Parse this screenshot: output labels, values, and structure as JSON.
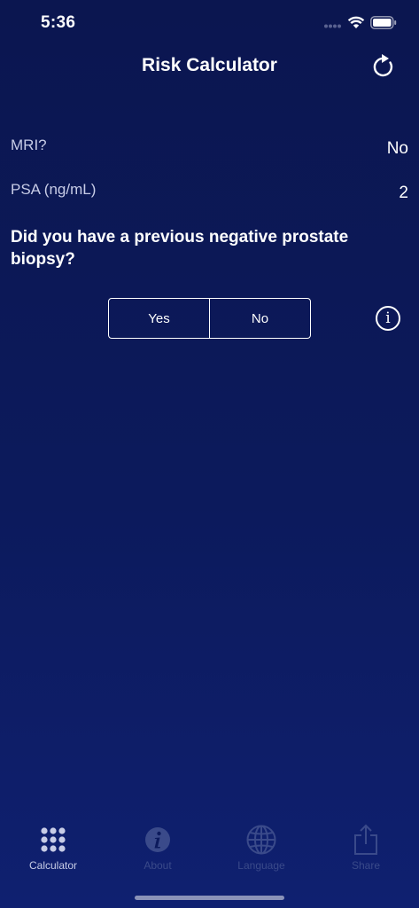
{
  "status_bar": {
    "time": "5:36"
  },
  "nav": {
    "title": "Risk Calculator",
    "refresh_icon": "refresh-icon"
  },
  "rows": [
    {
      "label": "MRI?",
      "value": "No"
    },
    {
      "label": "PSA (ng/mL)",
      "value": "2"
    }
  ],
  "question": {
    "text": "Did you have a previous negative prostate biopsy?",
    "options": [
      "Yes",
      "No"
    ],
    "info_icon": "info-icon",
    "info_glyph": "i"
  },
  "tabs": [
    {
      "label": "Calculator",
      "icon": "grid-icon",
      "active": true
    },
    {
      "label": "About",
      "icon": "info-icon",
      "active": false
    },
    {
      "label": "Language",
      "icon": "globe-icon",
      "active": false
    },
    {
      "label": "Share",
      "icon": "share-icon",
      "active": false
    }
  ],
  "colors": {
    "background": "#0c1a5c",
    "active_tab": "#c7cce6",
    "inactive_tab": "#3a4a8a"
  }
}
